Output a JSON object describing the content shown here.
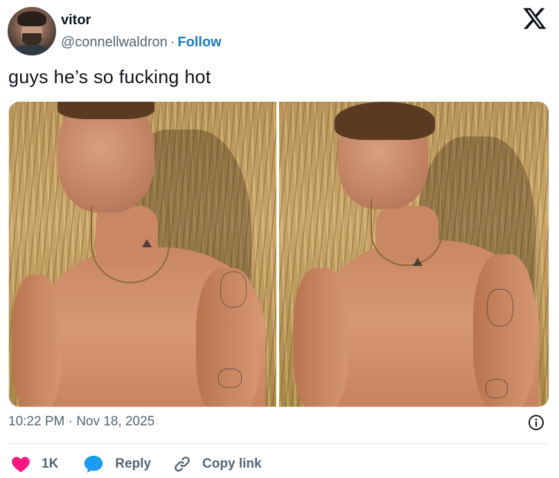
{
  "author": {
    "name": "vitor",
    "handle": "@connellwaldron",
    "separator": "·",
    "follow_label": "Follow"
  },
  "tweet": {
    "text": "guys he’s so fucking hot",
    "timestamp": "10:22 PM · Nov 18, 2025"
  },
  "actions": {
    "like_count": "1K",
    "reply_label": "Reply",
    "copy_label": "Copy link"
  },
  "icons": {
    "brand": "x-logo-icon",
    "info": "info-icon",
    "like": "heart-icon",
    "reply": "reply-bubble-icon",
    "copy": "link-icon"
  },
  "colors": {
    "follow_link": "#1d7bc2",
    "like_heart": "#f91880",
    "reply_bubble": "#1d9bf0",
    "muted_text": "#536471"
  }
}
